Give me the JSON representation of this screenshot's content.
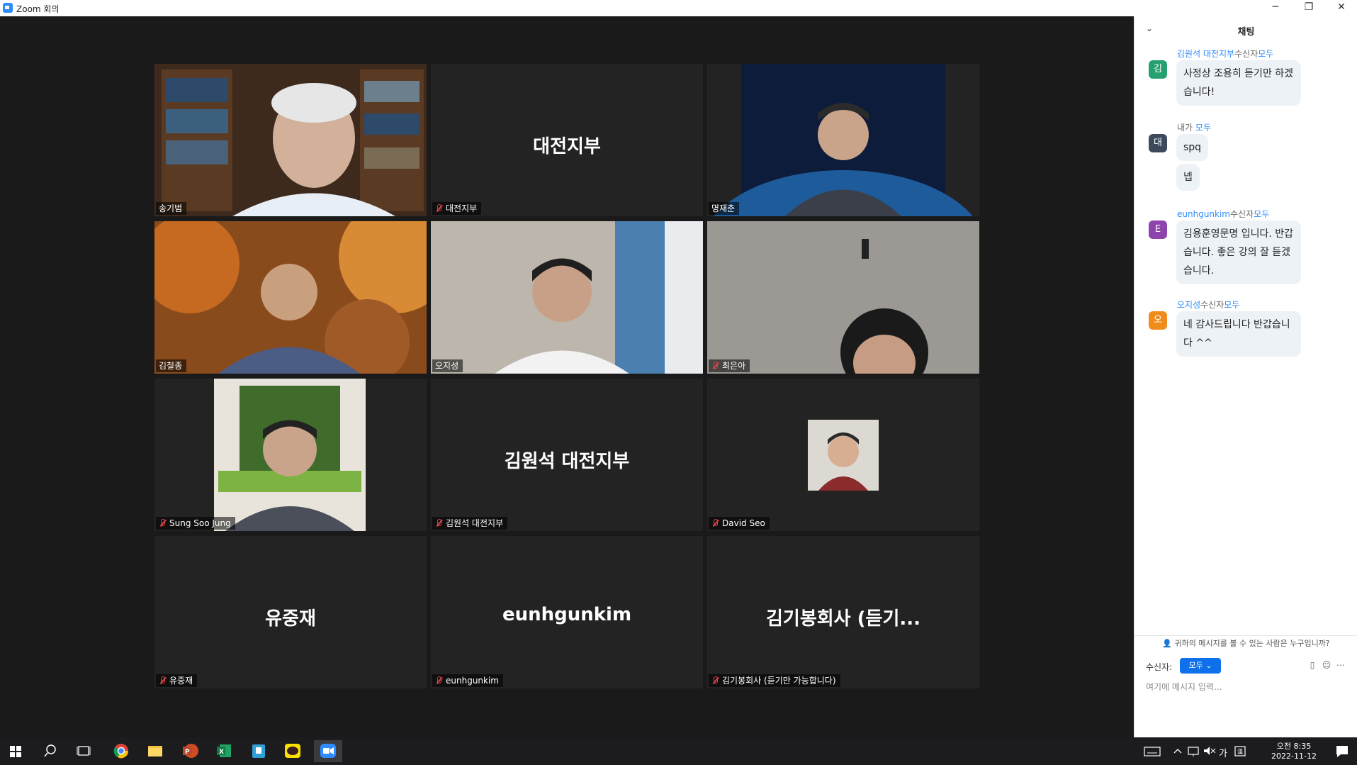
{
  "window": {
    "title": "Zoom 회의",
    "minimize": "─",
    "restore": "❐",
    "close": "✕"
  },
  "participants": [
    {
      "name": "송기범",
      "tile_text": ""
    },
    {
      "name": "대전지부",
      "tile_text": "대전지부"
    },
    {
      "name": "명재춘",
      "tile_text": ""
    },
    {
      "name": "김철종",
      "tile_text": ""
    },
    {
      "name": "오지성",
      "tile_text": ""
    },
    {
      "name": "최은아",
      "tile_text": ""
    },
    {
      "name": "Sung Soo Jung",
      "tile_text": ""
    },
    {
      "name": "김원석 대전지부",
      "tile_text": "김원석 대전지부"
    },
    {
      "name": "David Seo",
      "tile_text": ""
    },
    {
      "name": "유중재",
      "tile_text": "유중재"
    },
    {
      "name": "eunhgunkim",
      "tile_text": "eunhgunkim"
    },
    {
      "name": "김기봉회사 (듣기만 가능합니다)",
      "tile_text": "김기봉회사 (듣기..."
    }
  ],
  "chat": {
    "title": "채팅",
    "collapse_icon": "⌄",
    "messages": [
      {
        "sender": "김원석 대전지부",
        "to_label": "수신자",
        "to": "모두",
        "avatar": "김",
        "avatar_color": "#27a06f",
        "text": "사정상 조용히 듣기만 하겠습니다!"
      },
      {
        "sender": "내가",
        "to_label": "",
        "to": "모두",
        "avatar": "대",
        "avatar_color": "#3d4a5c",
        "text": "spq",
        "text2": "넵"
      },
      {
        "sender": "eunhgunkim",
        "to_label": "수신자",
        "to": "모두",
        "avatar": "E",
        "avatar_color": "#8e44ad",
        "text": "김용훈영문명 입니다. 반갑습니다. 좋은 강의 잘 듣겠습니다."
      },
      {
        "sender": "오지성",
        "to_label": "수신자",
        "to": "모두",
        "avatar": "오",
        "avatar_color": "#f08c1b",
        "text": "네 감사드립니다 반갑습니다 ^^"
      }
    ],
    "footer_hint": "귀하의 메시지를 볼 수 있는 사람은 누구입니까?",
    "recipient_label": "수신자:",
    "recipient_value": "모두",
    "input_placeholder": "여기에 메시지 입력..."
  },
  "taskbar": {
    "time": "오전 8:35",
    "date": "2022-11-12",
    "ime": "가"
  }
}
